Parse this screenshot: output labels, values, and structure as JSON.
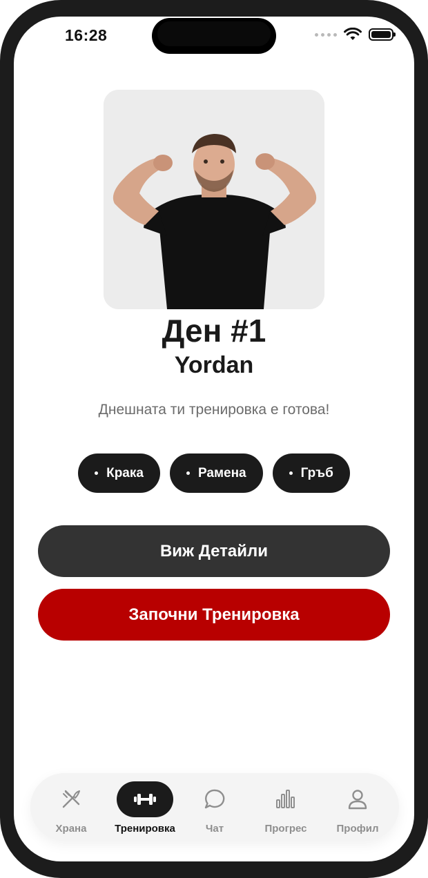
{
  "status_bar": {
    "time": "16:28"
  },
  "workout": {
    "day_title": "Ден #1",
    "user_name": "Yordan",
    "subtitle": "Днешната ти тренировка е готова!",
    "muscle_tags": [
      "Крака",
      "Рамена",
      "Гръб"
    ]
  },
  "actions": {
    "details_label": "Виж Детайли",
    "start_label": "Започни Тренировка"
  },
  "tabbar": {
    "items": [
      {
        "label": "Храна",
        "icon": "fork-knife-icon",
        "active": false
      },
      {
        "label": "Тренировка",
        "icon": "dumbbell-icon",
        "active": true
      },
      {
        "label": "Чат",
        "icon": "chat-bubble-icon",
        "active": false
      },
      {
        "label": "Прогрес",
        "icon": "bar-chart-icon",
        "active": false
      },
      {
        "label": "Профил",
        "icon": "person-icon",
        "active": false
      }
    ]
  },
  "colors": {
    "accent_red": "#b80000",
    "dark": "#1b1b1b",
    "button_dark": "#333333"
  }
}
